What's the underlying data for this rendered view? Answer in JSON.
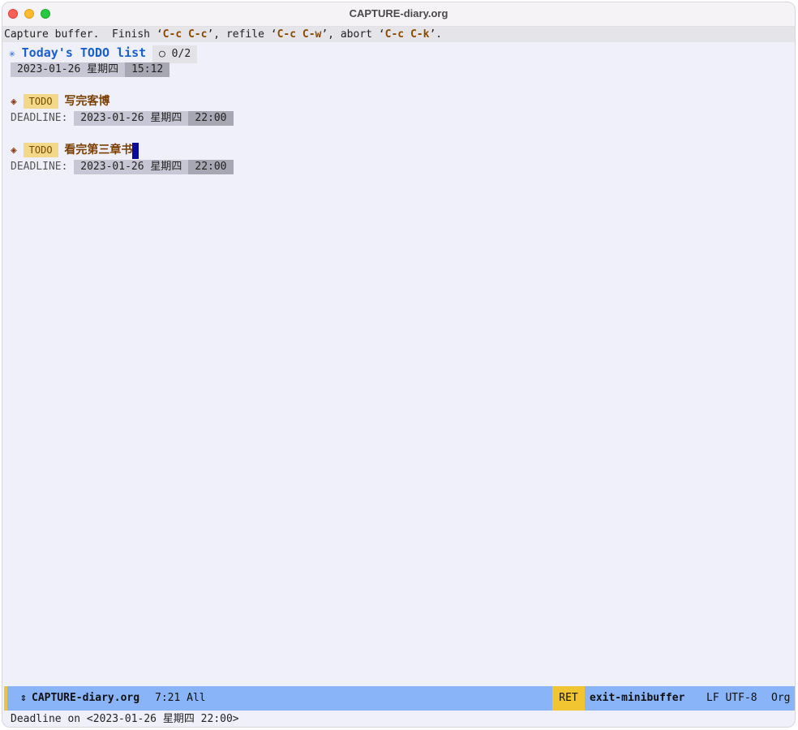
{
  "window": {
    "title": "CAPTURE-diary.org"
  },
  "header": {
    "prefix": "Capture buffer.  Finish ‘",
    "finish_key": "C-c C-c",
    "mid1": "’, refile ‘",
    "refile_key": "C-c C-w",
    "mid2": "’, abort ‘",
    "abort_key": "C-c C-k",
    "suffix": "’."
  },
  "heading": {
    "bullet": "✳",
    "title": "Today's TODO list",
    "progress": "○ 0/2",
    "timestamp_date": "2023-01-26 星期四",
    "timestamp_time": "15:12"
  },
  "tasks": [
    {
      "bullet": "◈",
      "keyword": "TODO",
      "title": "写完客博",
      "deadline_label": "DEADLINE:",
      "deadline_date": "2023-01-26 星期四",
      "deadline_time": "22:00"
    },
    {
      "bullet": "◈",
      "keyword": "TODO",
      "title": "看完第三章书",
      "deadline_label": "DEADLINE:",
      "deadline_date": "2023-01-26 星期四",
      "deadline_time": "22:00"
    }
  ],
  "modeline": {
    "arrows": "⇕",
    "buffer_name": "CAPTURE-diary.org",
    "position": "7:21 All",
    "ret": "RET",
    "command": "exit-minibuffer",
    "encoding": "LF UTF-8",
    "mode": "Org"
  },
  "echo_area": {
    "text": "Deadline on <2023-01-26 星期四 22:00>"
  },
  "colors": {
    "background": "#f0f0fb",
    "modeline": "#89b4f8",
    "heading": "#1a5fd1",
    "todo_badge": "#f4d88a",
    "task_title": "#7a3e00",
    "cursor": "#0a0a9a"
  }
}
